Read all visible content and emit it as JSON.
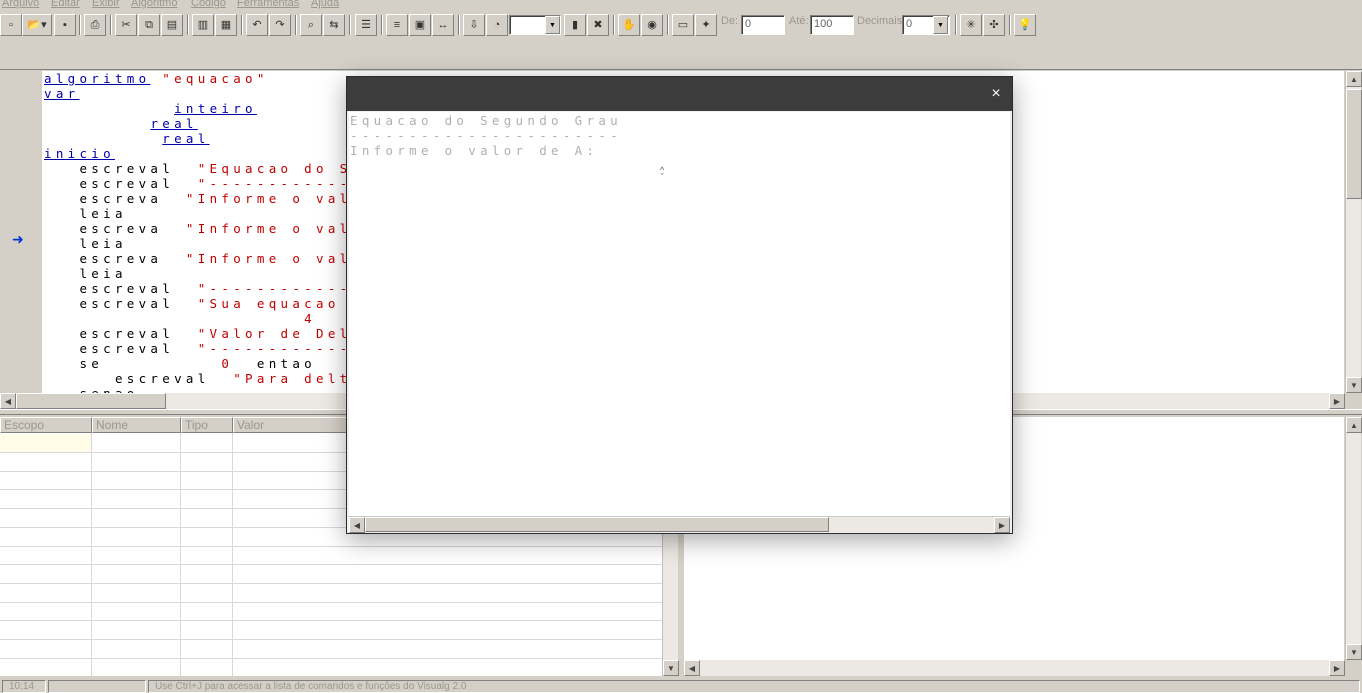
{
  "menu": [
    "Arquivo",
    "Editar",
    "Exibir",
    "Algoritmo",
    "Código",
    "Ferramentas",
    "Ajuda"
  ],
  "toolbar": {
    "from_label": "De:",
    "from_value": "0",
    "to_label": "Até:",
    "to_value": "100",
    "decimals_label": "Decimais:",
    "decimals_value": "0",
    "speed_value": ""
  },
  "editor": {
    "lines": [
      [
        {
          "t": "algoritmo",
          "c": "kw"
        },
        {
          "t": " "
        },
        {
          "t": "\"equacao\"",
          "c": "st"
        }
      ],
      [
        {
          "t": "var",
          "c": "kw"
        }
      ],
      [
        {
          "t": "           "
        },
        {
          "t": "inteiro",
          "c": "kw"
        }
      ],
      [
        {
          "t": "         "
        },
        {
          "t": "real",
          "c": "kw"
        }
      ],
      [
        {
          "t": "          "
        },
        {
          "t": "real",
          "c": "kw"
        }
      ],
      [
        {
          "t": "inicio",
          "c": "kw"
        }
      ],
      [
        {
          "t": "   escreval  "
        },
        {
          "t": "\"Equacao do Seg",
          "c": "st"
        }
      ],
      [
        {
          "t": "   escreval  "
        },
        {
          "t": "\"--------------",
          "c": "st"
        }
      ],
      [
        {
          "t": "   escreva  "
        },
        {
          "t": "\"Informe o valor",
          "c": "st"
        }
      ],
      [
        {
          "t": "   leia"
        }
      ],
      [
        {
          "t": "   escreva  "
        },
        {
          "t": "\"Informe o valor",
          "c": "st"
        }
      ],
      [
        {
          "t": "   leia"
        }
      ],
      [
        {
          "t": "   escreva  "
        },
        {
          "t": "\"Informe o valor",
          "c": "st"
        }
      ],
      [
        {
          "t": "   leia"
        }
      ],
      [
        {
          "t": "   escreval  "
        },
        {
          "t": "\"--------------",
          "c": "st"
        }
      ],
      [
        {
          "t": "   escreval  "
        },
        {
          "t": "\"Sua equacao e:",
          "c": "st"
        }
      ],
      [
        {
          "t": "                      "
        },
        {
          "t": "4",
          "c": "nb"
        }
      ],
      [
        {
          "t": "   escreval  "
        },
        {
          "t": "\"Valor de Delta",
          "c": "st"
        }
      ],
      [
        {
          "t": "   escreval  "
        },
        {
          "t": "\"--------------",
          "c": "st"
        }
      ],
      [
        {
          "t": "   se          "
        },
        {
          "t": "0",
          "c": "nb"
        },
        {
          "t": "  entao"
        }
      ],
      [
        {
          "t": "      escreval  "
        },
        {
          "t": "\"Para delta",
          "c": "st"
        }
      ],
      [
        {
          "t": "   senao"
        }
      ]
    ]
  },
  "grid": {
    "columns": [
      "Escopo",
      "Nome",
      "Tipo",
      "Valor"
    ]
  },
  "status": {
    "time": "10:14",
    "mode": "",
    "hint": "Use Ctrl+J para acessar a lista de comandos e funções do Visualg 2.0"
  },
  "dialog": {
    "output_lines": [
      "Equacao do Segundo Grau",
      "-----------------------",
      "Informe o valor de A:"
    ],
    "close_icon": "close-icon"
  },
  "colors": {
    "keyword": "#0000aa",
    "string": "#c00000",
    "dialog_titlebar": "#3c3c3c"
  }
}
